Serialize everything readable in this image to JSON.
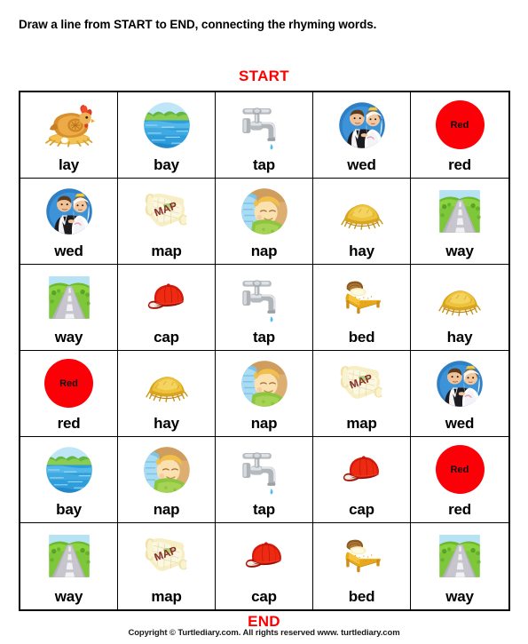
{
  "worksheet": {
    "instruction": "Draw a line from START to END, connecting the rhyming words.",
    "start_label": "START",
    "end_label": "END",
    "copyright": "Copyright © Turtlediary.com. All rights reserved   www. turtlediary.com"
  },
  "colors": {
    "start_end": "#ff0000",
    "red_circle": "#fb0007",
    "grid_line": "#000000",
    "text": "#000000"
  },
  "grid": {
    "rows": 6,
    "columns": 5,
    "cells": [
      {
        "word": "lay",
        "icon": "hen-on-nest-icon"
      },
      {
        "word": "bay",
        "icon": "bay-water-icon"
      },
      {
        "word": "tap",
        "icon": "faucet-icon"
      },
      {
        "word": "wed",
        "icon": "wedding-couple-icon"
      },
      {
        "word": "red",
        "icon": "red-circle-icon",
        "icon_text": "Red"
      },
      {
        "word": "wed",
        "icon": "wedding-couple-icon"
      },
      {
        "word": "map",
        "icon": "map-scroll-icon",
        "icon_text": "MAP"
      },
      {
        "word": "nap",
        "icon": "sleeping-child-icon"
      },
      {
        "word": "hay",
        "icon": "haystack-icon"
      },
      {
        "word": "way",
        "icon": "road-icon"
      },
      {
        "word": "way",
        "icon": "road-icon"
      },
      {
        "word": "cap",
        "icon": "baseball-cap-icon"
      },
      {
        "word": "tap",
        "icon": "faucet-icon"
      },
      {
        "word": "bed",
        "icon": "bed-icon"
      },
      {
        "word": "hay",
        "icon": "haystack-icon"
      },
      {
        "word": "red",
        "icon": "red-circle-icon",
        "icon_text": "Red"
      },
      {
        "word": "hay",
        "icon": "haystack-icon"
      },
      {
        "word": "nap",
        "icon": "sleeping-child-icon"
      },
      {
        "word": "map",
        "icon": "map-scroll-icon",
        "icon_text": "MAP"
      },
      {
        "word": "wed",
        "icon": "wedding-couple-icon"
      },
      {
        "word": "bay",
        "icon": "bay-water-icon"
      },
      {
        "word": "nap",
        "icon": "sleeping-child-icon"
      },
      {
        "word": "tap",
        "icon": "faucet-icon"
      },
      {
        "word": "cap",
        "icon": "baseball-cap-icon"
      },
      {
        "word": "red",
        "icon": "red-circle-icon",
        "icon_text": "Red"
      },
      {
        "word": "way",
        "icon": "road-icon"
      },
      {
        "word": "map",
        "icon": "map-scroll-icon",
        "icon_text": "MAP"
      },
      {
        "word": "cap",
        "icon": "baseball-cap-icon"
      },
      {
        "word": "bed",
        "icon": "bed-icon"
      },
      {
        "word": "way",
        "icon": "road-icon"
      }
    ]
  }
}
